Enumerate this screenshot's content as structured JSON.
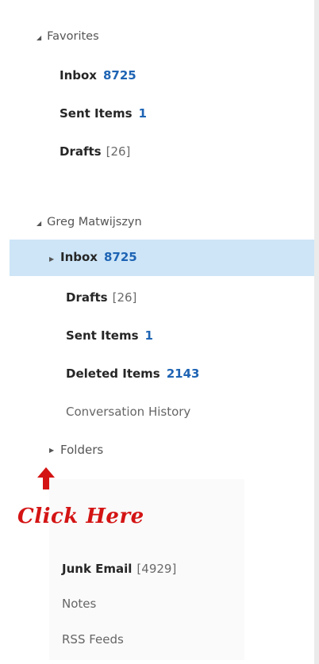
{
  "favorites": {
    "header": "Favorites",
    "items": [
      {
        "label": "Inbox",
        "count": "8725"
      },
      {
        "label": "Sent Items",
        "count": "1"
      },
      {
        "label": "Drafts",
        "count": "[26]"
      }
    ]
  },
  "account": {
    "header": "Greg Matwijszyn",
    "items": [
      {
        "label": "Inbox",
        "count": "8725"
      },
      {
        "label": "Drafts",
        "count": "[26]"
      },
      {
        "label": "Sent Items",
        "count": "1"
      },
      {
        "label": "Deleted Items",
        "count": "2143"
      },
      {
        "label": "Conversation History"
      },
      {
        "label": "Folders"
      },
      {
        "label": "Junk Email",
        "count": "[4929]"
      },
      {
        "label": "Notes"
      },
      {
        "label": "RSS Feeds"
      }
    ]
  },
  "annotation": {
    "text": "Click Here",
    "color": "#d41414"
  },
  "colors": {
    "selected_bg": "#cde5f7",
    "count_blue": "#1e64b4"
  },
  "icons": {
    "expanded": "triangle-down-icon",
    "collapsed": "triangle-right-icon",
    "pointer": "red-arrow-up-icon"
  }
}
